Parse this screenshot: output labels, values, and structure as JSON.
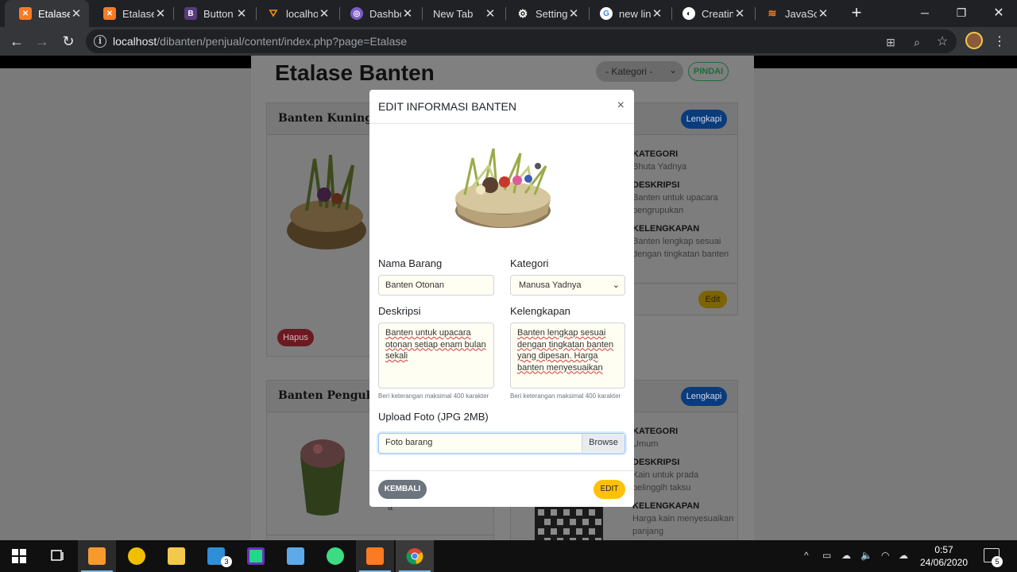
{
  "browser": {
    "tabs": [
      {
        "label": "Etalase",
        "active": true,
        "favicon": "xampp-icon",
        "color": "#fb7a24"
      },
      {
        "label": "Etalase",
        "active": false,
        "favicon": "xampp-icon",
        "color": "#fb7a24"
      },
      {
        "label": "Button",
        "active": false,
        "favicon": "bootstrap-icon",
        "color": "#563d7c"
      },
      {
        "label": "localhost",
        "active": false,
        "favicon": "phpmyadmin-icon",
        "color": "#f29111"
      },
      {
        "label": "Dashbo",
        "active": false,
        "favicon": "dashboard-icon",
        "color": "#7c5cc4"
      },
      {
        "label": "New Tab",
        "active": false,
        "favicon": "",
        "color": ""
      },
      {
        "label": "Settings",
        "active": false,
        "favicon": "gear-icon",
        "color": "#dadce0"
      },
      {
        "label": "new line",
        "active": false,
        "favicon": "google-icon",
        "color": "#4285f4"
      },
      {
        "label": "Creating",
        "active": false,
        "favicon": "globe-icon",
        "color": "#dadce0"
      },
      {
        "label": "JavaScr",
        "active": false,
        "favicon": "stackoverflow-icon",
        "color": "#f48024"
      }
    ],
    "url_host": "localhost",
    "url_path": "/dibanten/penjual/content/index.php?page=Etalase"
  },
  "page": {
    "title": "Etalase Banten",
    "category_filter": "- Kategori -",
    "scan_label": "PINDAI",
    "cards": [
      {
        "title": "Banten Kuningan",
        "lengkapi_label": "Lengkapi",
        "hapus_label": "Hapus",
        "edit_label": "Edit",
        "info": [
          {
            "key": "KATEGORI",
            "value": "Bhuta Yadnya"
          },
          {
            "key": "DESKRIPSI",
            "value": "Banten untuk upacara pengrupukan"
          },
          {
            "key": "KELENGKAPAN",
            "value": "Banten lengkap sesuai dengan tingkatan banten"
          }
        ]
      },
      {
        "title": "Banten Pengulap",
        "lengkapi_label": "Lengkapi",
        "info": [
          {
            "key": "KATEGORI",
            "value": "Umum"
          },
          {
            "key": "DESKRIPSI",
            "value": "Kain untuk prada pelinggih taksu"
          },
          {
            "key": "KELENGKAPAN",
            "value": "Harga kain menyesuaikan panjang"
          }
        ],
        "fragment": "a"
      }
    ]
  },
  "modal": {
    "title": "EDIT INFORMASI BANTEN",
    "close": "×",
    "nama_label": "Nama Barang",
    "nama_value": "Banten Otonan",
    "kategori_label": "Kategori",
    "kategori_value": "Manusa Yadnya",
    "deskripsi_label": "Deskripsi",
    "deskripsi_value": "Banten untuk upacara otonan setiap enam bulan sekali",
    "kelengkapan_label": "Kelengkapan",
    "kelengkapan_value": "Banten lengkap sesuai dengan tingkatan banten yang dipesan. Harga banten menyesuaikan",
    "help_deskripsi": "Beri keterangan maksimal 400 karakter",
    "help_kelengkapan": "Beri keterangan maksimal 400 karakter",
    "upload_label": "Upload Foto (JPG 2MB)",
    "upload_placeholder": "Foto barang",
    "browse_label": "Browse",
    "back_label": "KEMBALI",
    "edit_label": "EDIT"
  },
  "taskbar": {
    "time": "0:57",
    "date": "24/06/2020",
    "mail_badge": "3",
    "notif_count": "5",
    "apps": [
      "windows-start-icon",
      "task-view-icon",
      "sublime-text-icon",
      "autodesk-icon",
      "file-explorer-icon",
      "mail-icon",
      "jetbrains-icon",
      "3d-box-icon",
      "android-studio-icon",
      "xampp-icon",
      "chrome-icon"
    ]
  }
}
